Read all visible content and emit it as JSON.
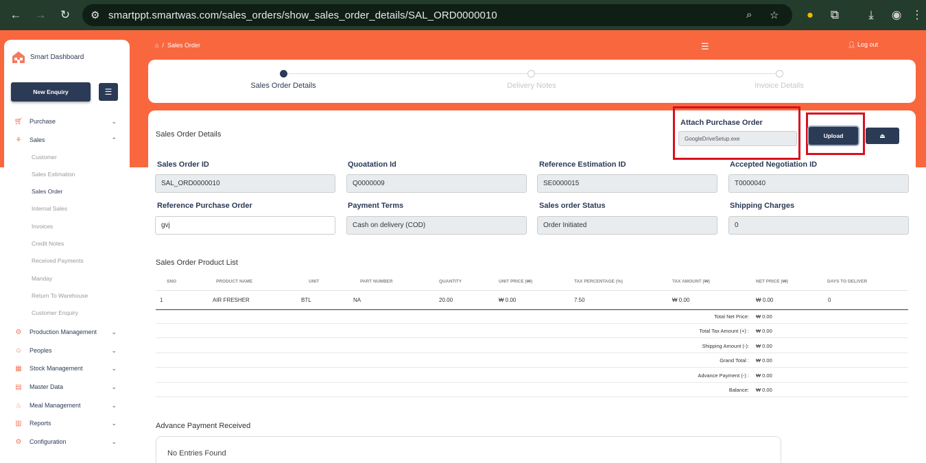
{
  "browser": {
    "url": "smartppt.smartwas.com/sales_orders/show_sales_order_details/SAL_ORD0000010"
  },
  "sidebar": {
    "brand": "Smart Dashboard",
    "new_enquiry": "New Enquiry",
    "menu": [
      {
        "label": "Purchase",
        "icon": "cart-icon"
      },
      {
        "label": "Sales",
        "icon": "sales-icon"
      },
      {
        "label": "Production Management",
        "icon": "factory-icon"
      },
      {
        "label": "Peoples",
        "icon": "people-icon"
      },
      {
        "label": "Stock Management",
        "icon": "stock-icon"
      },
      {
        "label": "Master Data",
        "icon": "database-icon"
      },
      {
        "label": "Meal Management",
        "icon": "meal-icon"
      },
      {
        "label": "Reports",
        "icon": "reports-icon"
      },
      {
        "label": "Configuration",
        "icon": "config-icon"
      }
    ],
    "sales_sub": [
      "Customer",
      "Sales Estimation",
      "Sales Order",
      "Internal Sales",
      "Invoices",
      "Credit Notes",
      "Received Payments",
      "Manday",
      "Return To Warehouse",
      "Customer Enquiry"
    ],
    "active_sub": "Sales Order"
  },
  "header": {
    "breadcrumb": "Sales Order",
    "logout": "Log out"
  },
  "stepper": {
    "steps": [
      "Sales Order Details",
      "Delivery Notes",
      "Invoice Details"
    ],
    "active_index": 0
  },
  "main": {
    "title": "Sales Order Details",
    "attach_label": "Attach Purchase Order",
    "attach_file": "GoogleDriveSetup.exe",
    "upload_label": "Upload",
    "fields": [
      {
        "label": "Sales Order ID",
        "value": "SAL_ORD0000010"
      },
      {
        "label": "Quoatation Id",
        "value": "Q0000009"
      },
      {
        "label": "Reference Estimation ID",
        "value": "SE0000015"
      },
      {
        "label": "Accepted Negotiation ID",
        "value": "T0000040"
      },
      {
        "label": "Reference Purchase Order",
        "value": "gvj"
      },
      {
        "label": "Payment Terms",
        "value": "Cash on delivery (COD)"
      },
      {
        "label": "Sales order Status",
        "value": "Order Initiated"
      },
      {
        "label": "Shipping Charges",
        "value": "0"
      }
    ],
    "product_list_title": "Sales Order Product List",
    "table_headers": [
      "SNO",
      "PRODUCT NAME",
      "UNIT",
      "PART NUMBER",
      "QUANTITY",
      "UNIT PRICE (₩)",
      "TAX PERCENTAGE (%)",
      "TAX AMOUNT (₩)",
      "NET PRICE (₩)",
      "DAYS TO DELIVER"
    ],
    "table_row": [
      "1",
      "AIR FRESHER",
      "BTL",
      "NA",
      "20.00",
      "₩ 0.00",
      "7.50",
      "₩ 0.00",
      "₩ 0.00",
      "0"
    ],
    "summary": [
      {
        "label": "Total Net Price:",
        "value": "₩ 0.00"
      },
      {
        "label": "Total Tax Amount (+) :",
        "value": "₩ 0.00"
      },
      {
        "label": "Shipping Amount (-):",
        "value": "₩ 0.00"
      },
      {
        "label": "Grand Total :",
        "value": "₩ 0.00"
      },
      {
        "label": "Advance Payment (-) :",
        "value": "₩ 0.00"
      },
      {
        "label": "Balance:",
        "value": "₩ 0.00"
      }
    ],
    "advance_title": "Advance Payment Received",
    "no_entries": "No Entries Found"
  },
  "colors": {
    "brand_orange": "#f9673f",
    "navy": "#2b3a55",
    "highlight_red": "#d80f1c"
  }
}
